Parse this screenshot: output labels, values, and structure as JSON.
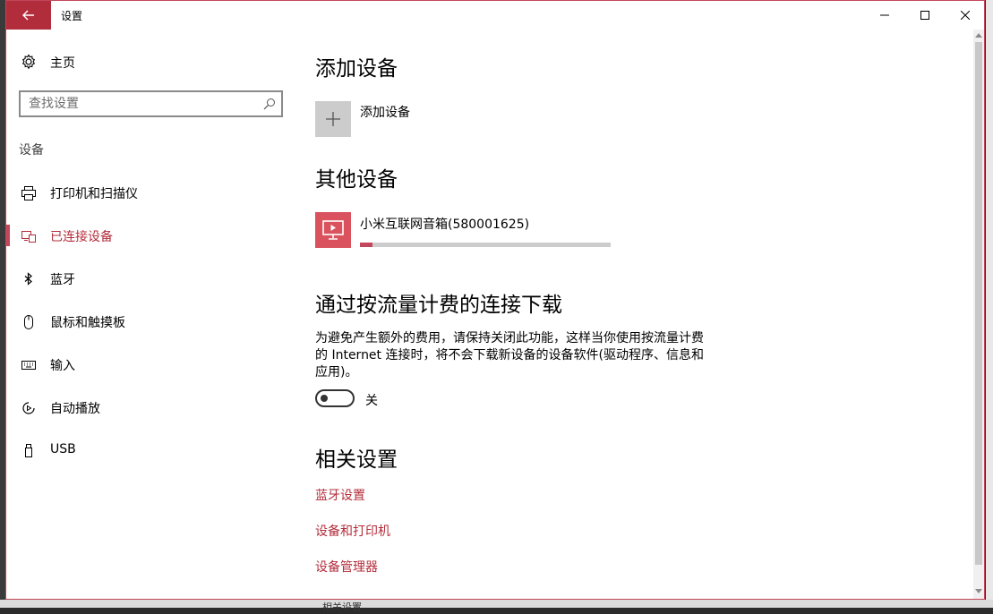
{
  "window": {
    "title": "设置"
  },
  "sidebar": {
    "home_label": "主页",
    "search_placeholder": "查找设置",
    "section_label": "设备",
    "items": [
      {
        "label": "打印机和扫描仪",
        "icon": "printer-icon"
      },
      {
        "label": "已连接设备",
        "icon": "connected-devices-icon",
        "active": true
      },
      {
        "label": "蓝牙",
        "icon": "bluetooth-icon"
      },
      {
        "label": "鼠标和触摸板",
        "icon": "mouse-icon"
      },
      {
        "label": "输入",
        "icon": "keyboard-icon"
      },
      {
        "label": "自动播放",
        "icon": "autoplay-icon"
      },
      {
        "label": "USB",
        "icon": "usb-icon"
      }
    ]
  },
  "main": {
    "add_section_title": "添加设备",
    "add_device_label": "添加设备",
    "other_section_title": "其他设备",
    "device": {
      "name": "小米互联网音箱(580001625)",
      "progress_fraction": 0.05
    },
    "metered_title": "通过按流量计费的连接下载",
    "metered_desc": "为避免产生额外的费用，请保持关闭此功能，这样当你使用按流量计费的 Internet 连接时，将不会下载新设备的设备软件(驱动程序、信息和应用)。",
    "toggle_state": "关",
    "related_title": "相关设置",
    "related_links": [
      "蓝牙设置",
      "设备和打印机",
      "设备管理器"
    ]
  },
  "background": {
    "partial_text": "相关设置"
  },
  "colors": {
    "accent": "#b22d3b",
    "tile_gray": "#cccccc",
    "device_tile": "#d9525e"
  }
}
